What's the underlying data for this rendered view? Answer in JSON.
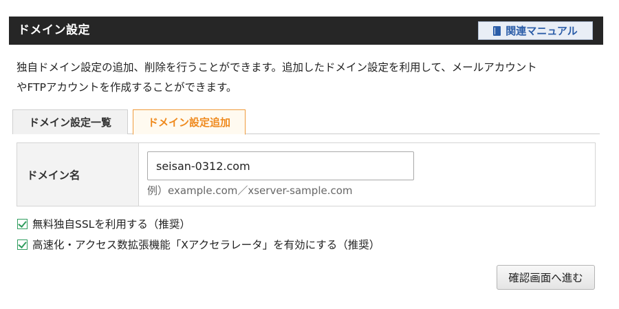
{
  "header": {
    "title": "ドメイン設定",
    "manual_button_label": "関連マニュアル",
    "manual_icon": "book-icon"
  },
  "description": {
    "line1": "独自ドメイン設定の追加、削除を行うことができます。追加したドメイン設定を利用して、メールアカウント",
    "line2": "やFTPアカウントを作成することができます。"
  },
  "tabs": [
    {
      "label": "ドメイン設定一覧",
      "active": false
    },
    {
      "label": "ドメイン設定追加",
      "active": true
    }
  ],
  "form": {
    "domain_label": "ドメイン名",
    "domain_value": "seisan-0312.com",
    "domain_hint": "例）example.com／xserver-sample.com"
  },
  "options": [
    {
      "label": "無料独自SSLを利用する（推奨）",
      "checked": true
    },
    {
      "label": "高速化・アクセス数拡張機能「Xアクセラレータ」を有効にする（推奨）",
      "checked": true
    }
  ],
  "confirm_button_label": "確認画面へ進む",
  "colors": {
    "header_bg": "#262626",
    "active_tab_accent": "#ef8a1e",
    "manual_link": "#2b5da8",
    "checkbox_green": "#2f9d5e"
  }
}
